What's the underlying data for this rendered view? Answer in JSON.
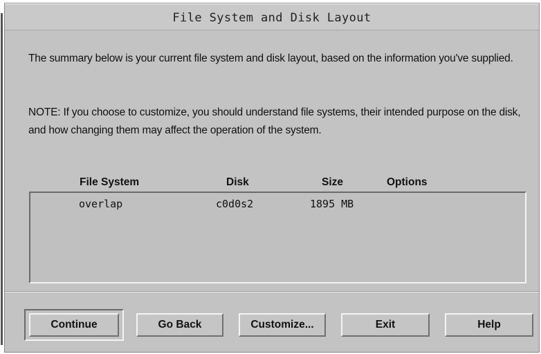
{
  "window": {
    "title": "File System and Disk Layout"
  },
  "intro": {
    "summary": "The summary below is your current file system and disk layout, based on the information you've supplied.",
    "note": "NOTE: If you choose to customize, you should understand file systems, their intended purpose on the disk, and how changing them may affect the operation of the system."
  },
  "table": {
    "columns": [
      "File System",
      "Disk",
      "Size",
      "Options"
    ],
    "rows": [
      {
        "file_system": "overlap",
        "disk": "c0d0s2",
        "size": "1895 MB",
        "options": ""
      }
    ]
  },
  "buttons": {
    "continue": "Continue",
    "go_back": "Go Back",
    "customize": "Customize...",
    "exit": "Exit",
    "help": "Help"
  },
  "colors": {
    "window_background": "#c3c3c3",
    "text": "#111111"
  }
}
